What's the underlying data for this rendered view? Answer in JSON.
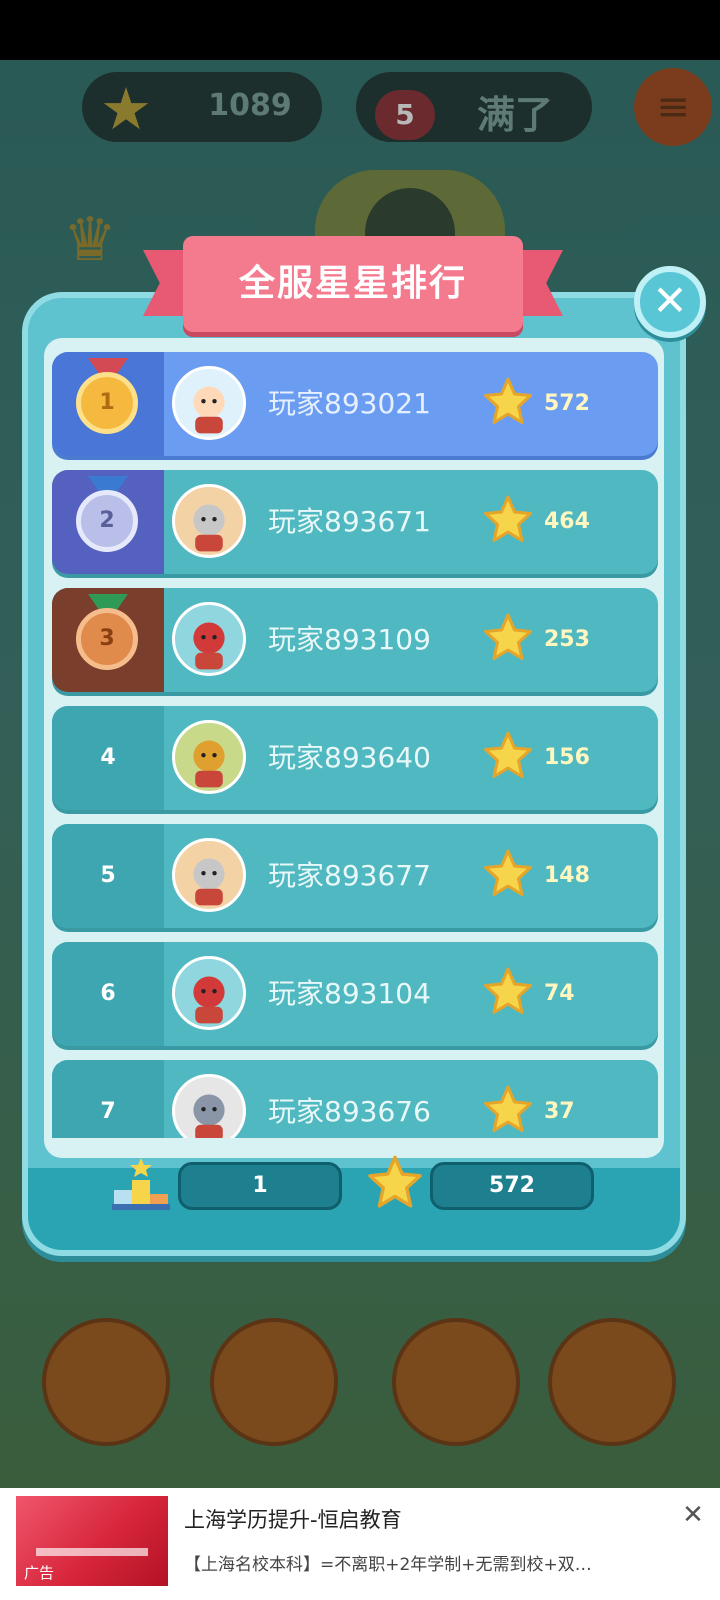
{
  "hud": {
    "star_total": "1089",
    "lives": "5",
    "lives_status": "满了"
  },
  "modal": {
    "title": "全服星星排行",
    "close_icon": "close-icon"
  },
  "leaderboard": [
    {
      "rank": "1",
      "medal": "gold",
      "name": "玩家893021",
      "stars": "572"
    },
    {
      "rank": "2",
      "medal": "silver",
      "name": "玩家893671",
      "stars": "464"
    },
    {
      "rank": "3",
      "medal": "bronze",
      "name": "玩家893109",
      "stars": "253"
    },
    {
      "rank": "4",
      "medal": "",
      "name": "玩家893640",
      "stars": "156"
    },
    {
      "rank": "5",
      "medal": "",
      "name": "玩家893677",
      "stars": "148"
    },
    {
      "rank": "6",
      "medal": "",
      "name": "玩家893104",
      "stars": "74"
    },
    {
      "rank": "7",
      "medal": "",
      "name": "玩家893676",
      "stars": "37"
    }
  ],
  "my_rank": {
    "rank": "1",
    "stars": "572"
  },
  "ad": {
    "thumb_label": "广告",
    "title": "上海学历提升-恒启教育",
    "description": "【上海名校本科】=不离职+2年学制+无需到校+双…"
  },
  "colors": {
    "row": "#4fb8c0",
    "row_first": "#6a9df2",
    "ribbon": "#f47a8e",
    "star": "#f7d54a"
  }
}
